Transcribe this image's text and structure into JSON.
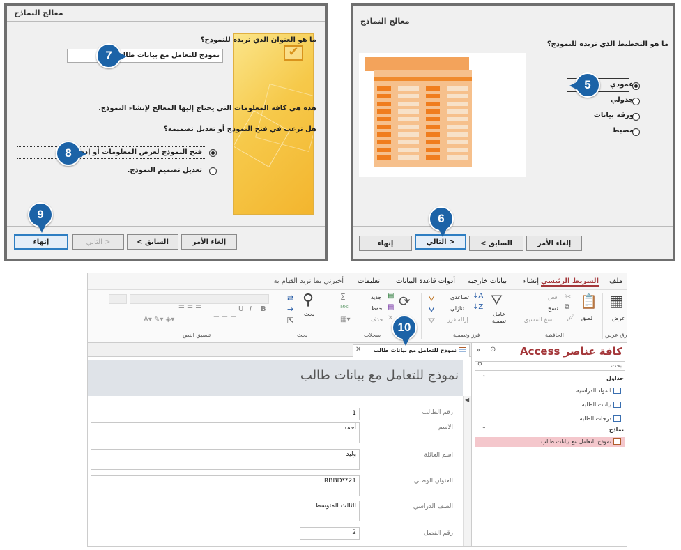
{
  "panel1": {
    "title": "معالج النماذج",
    "question_title": "ما هو العنوان الذي تريده للنموذج؟",
    "title_value": "نموذج للتعامل مع بيانات طالب",
    "info_text": "هذه هي كافة المعلومات التي يحتاج إليها المعالج لإنشاء النموذج.",
    "question_open": "هل ترغب في فتح النموذج أو تعديل تصميمه؟",
    "option_open": "فتح النموذج لعرض المعلومات أو إدخالها.",
    "option_modify": "تعديل تصميم النموذج.",
    "btn_cancel": "إلغاء الأمر",
    "btn_back": "< السابق",
    "btn_next": "التالي >",
    "btn_finish": "إنهاء",
    "badge7": "7",
    "badge8": "8",
    "badge9": "9"
  },
  "panel2": {
    "title": "معالج النماذج",
    "question": "ما هو التخطيط الذي تريده للنموذج؟",
    "options": [
      "عمودي",
      "جدولي",
      "ورقة بيانات",
      "مضبط"
    ],
    "btn_cancel": "إلغاء الأمر",
    "btn_back": "< السابق",
    "btn_next": "التالي >",
    "btn_finish": "إنهاء",
    "badge5": "5",
    "badge6": "6"
  },
  "ribbon": {
    "tabs": [
      "ملف",
      "الشريط الرئيسي",
      "إنشاء",
      "بيانات خارجية",
      "أدوات قاعدة البيانات",
      "تعليمات",
      "أخبرني بما تريد القيام به"
    ],
    "groups": [
      "طرق عرض",
      "الحافظة",
      "فرز وتصفية",
      "سجلات",
      "بحث",
      "تنسيق النص"
    ],
    "view_label": "عرض",
    "paste_label": "لصق",
    "cut_label": "قص",
    "copy_label": "نسخ",
    "format_painter": "نسخ التنسيق",
    "filter_label": "عامل تصفية",
    "asc_label": "تصاعدي",
    "desc_label": "تنازلي",
    "remove_sort": "إزالة فرز",
    "new_label": "جديد",
    "save_label": "حفظ",
    "delete_label": "حذف",
    "find_label": "بحث",
    "font_buttons": [
      "B",
      "I",
      "U"
    ]
  },
  "nav": {
    "title": "كافة عناصر Access",
    "search_placeholder": "بحث...",
    "section_tables": "جداول",
    "tables": [
      "المواد الدراسية",
      "بيانات الطلبة",
      "درجات الطلبة"
    ],
    "section_forms": "نماذج",
    "forms": [
      "نموذج للتعامل مع بيانات طالب"
    ]
  },
  "document": {
    "tab_label": "نموذج للتعامل مع بيانات طالب",
    "header": "نموذج للتعامل مع بيانات طالب",
    "badge10": "10",
    "fields": [
      {
        "label": "رقم الطالب",
        "value": "1"
      },
      {
        "label": "الاسم",
        "value": "أحمد"
      },
      {
        "label": "اسم العائلة",
        "value": "وليد"
      },
      {
        "label": "العنوان الوطني",
        "value": "RBBD**21"
      },
      {
        "label": "الصف الدراسي",
        "value": "الثالث المتوسط"
      },
      {
        "label": "رقم الفصل",
        "value": "2"
      }
    ]
  },
  "colors": {
    "badge": "#1c63a7",
    "access_red": "#a4373a",
    "selected_item": "#f4c7cc",
    "form_header": "#dfe3e8"
  }
}
